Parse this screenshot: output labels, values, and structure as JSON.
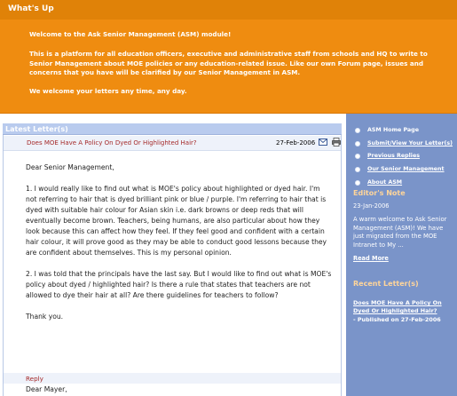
{
  "banner": {
    "title": "What's Up",
    "line1": "Welcome to the Ask Senior Management (ASM) module!",
    "line2": "This is a platform for all education officers, executive and administrative staff from schools and HQ to write to Senior Management about MOE policies or any education-related issue. Like our own Forum page, issues and concerns that you have will be clarified by our Senior Management in ASM.",
    "line3": "We welcome your letters any time, any day."
  },
  "latest": {
    "header": "Latest Letter(s)",
    "title": "Does MOE Have A Policy On Dyed Or Highlighted Hair?",
    "date": "27-Feb-2006",
    "icons": {
      "mail": "mail-icon",
      "print": "print-icon"
    },
    "body": [
      "Dear Senior Management,",
      "1.     I would really like to find out what is MOE's policy about highlighted or dyed hair. I'm not referring to hair that is dyed brilliant pink or blue / purple. I'm referring to hair that is dyed with suitable hair colour for Asian skin i.e. dark browns or deep reds that will eventually become brown. Teachers, being humans, are also particular about how they look because this can affect how they feel. If they feel good and confident with a certain hair colour, it will prove good as they may be able to conduct good lessons because they are confident about themselves. This is my personal opinion.",
      "2.     I was told that the principals have the last say. But I would like to find out what is MOE's policy about dyed / highlighted hair? Is there a rule that states that teachers are not allowed to dye their hair at all? Are there guidelines for teachers to follow?",
      "Thank you."
    ],
    "reply_label": "Reply",
    "reply_greeting": "Dear Mayer,"
  },
  "sidebar": {
    "nav": [
      {
        "label": "ASM Home Page",
        "link": false
      },
      {
        "label": "Submit/View Your Letter(s)",
        "link": true
      },
      {
        "label": "Previous Replies",
        "link": true
      },
      {
        "label": "Our Senior Management",
        "link": true
      },
      {
        "label": "About ASM",
        "link": true
      }
    ],
    "editor_heading": "Editor's Note",
    "editor_date": "23-Jan-2006",
    "editor_text": "A warm welcome to Ask Senior Management (ASM)! We have just migrated from the MOE Intranet to My ...",
    "read_more": "Read More",
    "recent_heading": "Recent Letter(s)",
    "recent_title": "Does MOE Have A Policy On Dyed Or Highlighted Hair?",
    "recent_published": "   -  Published on 27-Feb-2006"
  },
  "colors": {
    "banner": "#ef8c10",
    "sidebar": "#7a94c9",
    "header_blue": "#b9cbee",
    "link_red": "#a52a2a",
    "heading_peach": "#ffd59a"
  }
}
